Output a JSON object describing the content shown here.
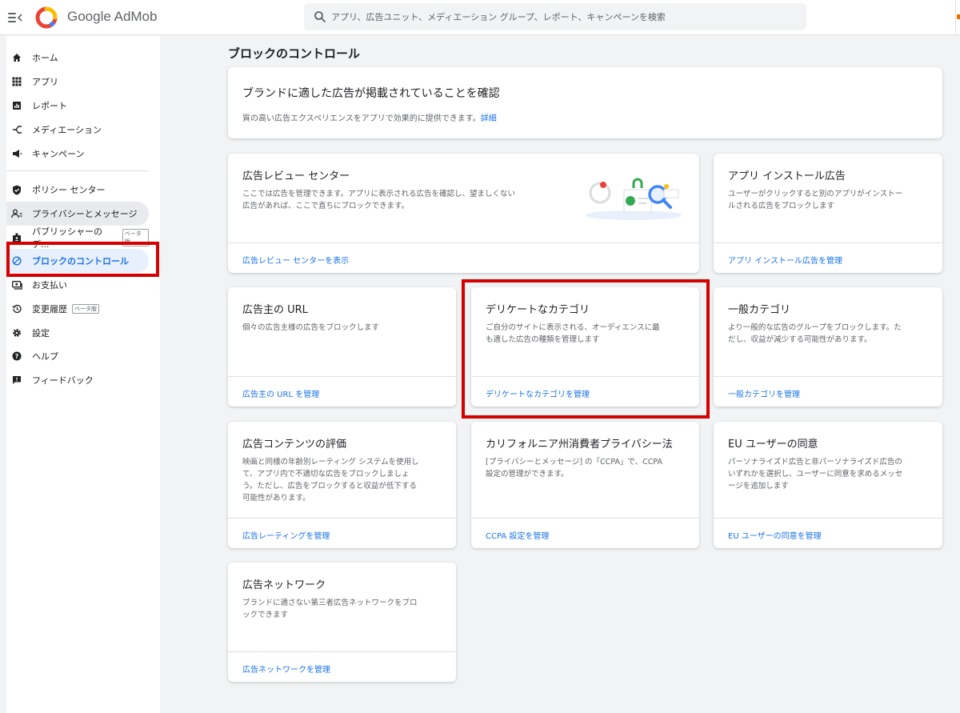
{
  "app": {
    "brand": "Google AdMob",
    "search_placeholder": "アプリ、広告ユニット、メディエーション グループ、レポート、キャンペーンを検索"
  },
  "sidebar": {
    "items": [
      {
        "label": "ホーム",
        "icon": "home-icon"
      },
      {
        "label": "アプリ",
        "icon": "apps-grid-icon"
      },
      {
        "label": "レポート",
        "icon": "report-icon"
      },
      {
        "label": "メディエーション",
        "icon": "mediation-icon"
      },
      {
        "label": "キャンペーン",
        "icon": "campaign-icon"
      },
      {
        "label": "ポリシー センター",
        "icon": "shield-icon"
      },
      {
        "label": "プライバシーとメッセージ",
        "icon": "privacy-icon"
      },
      {
        "label": "パブリッシャーのデ...",
        "icon": "badge-icon",
        "badge": "ベータ版"
      },
      {
        "label": "ブロックのコントロール",
        "icon": "block-icon"
      },
      {
        "label": "お支払い",
        "icon": "payments-icon"
      },
      {
        "label": "変更履歴",
        "icon": "history-icon",
        "badge": "ベータ版"
      },
      {
        "label": "設定",
        "icon": "gear-icon"
      },
      {
        "label": "ヘルプ",
        "icon": "help-icon"
      },
      {
        "label": "フィードバック",
        "icon": "feedback-icon"
      }
    ]
  },
  "main": {
    "title": "ブロックのコントロール",
    "hero": {
      "title": "ブランドに適した広告が掲載されていることを確認",
      "desc": "質の高い広告エクスペリエンスをアプリで効果的に提供できます。",
      "link": "詳細"
    },
    "cards": [
      {
        "title": "広告レビュー センター",
        "desc": [
          "ここでは広告を管理できます。アプリに表示される広告を確認し、望ましくない",
          "広告があれば、ここで直ちにブロックできます。"
        ],
        "link": "広告レビュー センターを表示"
      },
      {
        "title": "アプリ インストール広告",
        "desc": [
          "ユーザーがクリックすると別のアプリがインストー",
          "ルされる広告をブロックします"
        ],
        "link": "アプリ インストール広告を管理"
      },
      {
        "title": "広告主の URL",
        "desc": [
          "個々の広告主様の広告をブロックします"
        ],
        "link": "広告主の URL を管理"
      },
      {
        "title": "デリケートなカテゴリ",
        "desc": [
          "ご自分のサイトに表示される、オーディエンスに最",
          "も適した広告の種類を管理します"
        ],
        "link": "デリケートなカテゴリを管理"
      },
      {
        "title": "一般カテゴリ",
        "desc": [
          "より一般的な広告のグループをブロックします。た",
          "だし、収益が減少する可能性があります。"
        ],
        "link": "一般カテゴリを管理"
      },
      {
        "title": "広告コンテンツの評価",
        "desc": [
          "映画と同様の年齢別レーティング システムを使用し",
          "て、アプリ内で不適切な広告をブロックしましょ",
          "う。ただし、広告をブロックすると収益が低下する",
          "可能性があります。"
        ],
        "link": "広告レーティングを管理"
      },
      {
        "title": "カリフォルニア州消費者プライバシー法",
        "desc": [
          "[プライバシーとメッセージ] の「CCPA」で、CCPA",
          "設定の管理ができます。"
        ],
        "link": "CCPA 設定を管理"
      },
      {
        "title": "EU ユーザーの同意",
        "desc": [
          "パーソナライズド広告と非パーソナライズド広告の",
          "いずれかを選択し、ユーザーに同意を求めるメッセ",
          "ージを追加します"
        ],
        "link": "EU ユーザーの同意を管理"
      },
      {
        "title": "広告ネットワーク",
        "desc": [
          "ブランドに適さない第三者広告ネットワークをブロ",
          "ックできます"
        ],
        "link": "広告ネットワークを管理"
      }
    ]
  },
  "colors": {
    "accent": "#1a73e8",
    "highlight_box": "#d60000",
    "selected_bg": "#e8f0fe"
  }
}
